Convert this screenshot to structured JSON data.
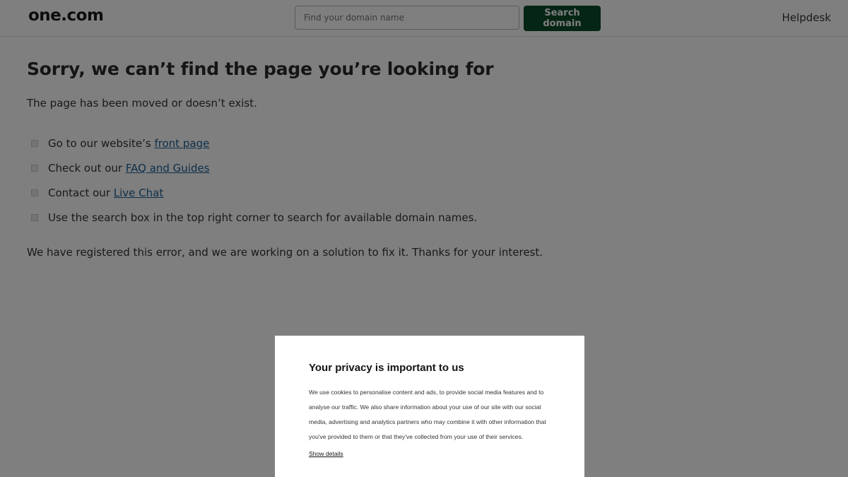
{
  "header": {
    "logo": "one.com",
    "search": {
      "placeholder": "Find your domain name",
      "value": ""
    },
    "search_button_label": "Search domain",
    "helpdesk_label": "Helpdesk"
  },
  "main": {
    "title": "Sorry, we can’t find the page you’re looking for",
    "subtitle": "The page has been moved or doesn’t exist.",
    "options": [
      {
        "prefix": "Go to our website’s ",
        "link": "front page"
      },
      {
        "prefix": "Check out our ",
        "link": "FAQ and Guides"
      },
      {
        "prefix": "Contact our ",
        "link": "Live Chat"
      },
      {
        "prefix": "Use the search box in the top right corner to search for available domain names.",
        "link": ""
      }
    ],
    "closing": "We have registered this error, and we are working on a solution to fix it. Thanks for your interest."
  },
  "cookie_dialog": {
    "title": "Your privacy is important to us",
    "body": "We use cookies to personalise content and ads, to provide social media features and to analyse our traffic. We also share information about your use of our site with our social media, advertising and analytics partners who may combine it with other information that you've provided to them or that they've collected from your use of their services.",
    "show_details_label": "Show details"
  },
  "colors": {
    "brand_button": "#0a4a2a",
    "link": "#1c5f93",
    "overlay": "rgba(0,0,0,0.5)"
  }
}
